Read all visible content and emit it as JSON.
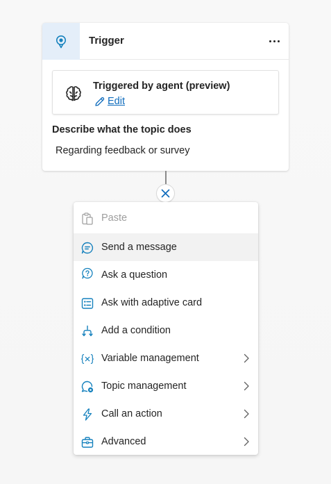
{
  "trigger": {
    "title": "Trigger",
    "more_icon": "more-horizontal-icon",
    "trigger_icon": "lightbulb-pin-icon",
    "agent": {
      "icon": "brain-icon",
      "title": "Triggered by agent (preview)",
      "edit_label": "Edit"
    },
    "describe_label": "Describe what the topic does",
    "describe_value": "Regarding feedback or survey"
  },
  "connector": {
    "close_icon": "close-icon"
  },
  "menu": {
    "items": [
      {
        "label": "Paste",
        "icon": "clipboard-icon",
        "disabled": true,
        "submenu": false
      },
      {
        "label": "Send a message",
        "icon": "chat-message-icon",
        "disabled": false,
        "submenu": false,
        "highlighted": true
      },
      {
        "label": "Ask a question",
        "icon": "question-bubble-icon",
        "disabled": false,
        "submenu": false
      },
      {
        "label": "Ask with adaptive card",
        "icon": "adaptive-card-icon",
        "disabled": false,
        "submenu": false
      },
      {
        "label": "Add a condition",
        "icon": "branch-icon",
        "disabled": false,
        "submenu": false
      },
      {
        "label": "Variable management",
        "icon": "variable-icon",
        "disabled": false,
        "submenu": true
      },
      {
        "label": "Topic management",
        "icon": "topic-settings-icon",
        "disabled": false,
        "submenu": true
      },
      {
        "label": "Call an action",
        "icon": "lightning-icon",
        "disabled": false,
        "submenu": true
      },
      {
        "label": "Advanced",
        "icon": "toolbox-icon",
        "disabled": false,
        "submenu": true
      }
    ]
  },
  "colors": {
    "accent": "#0f6cbd",
    "icon_accent": "#1581bd",
    "header_icon_bg": "#e4eef9",
    "hover_bg": "#f2f2f2"
  }
}
